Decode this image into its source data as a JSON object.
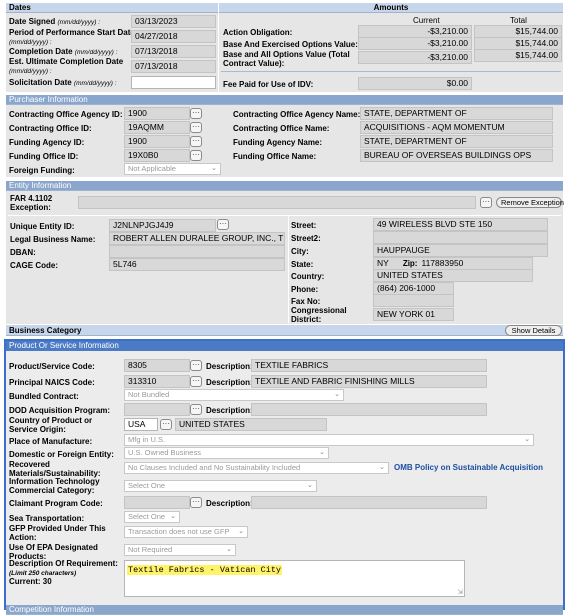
{
  "dates": {
    "header": "Dates",
    "date_signed_label": "Date Signed",
    "date_signed_hint": "(mm/dd/yyyy) :",
    "date_signed": "03/13/2023",
    "pop_start_label": "Period of Performance Start Date",
    "pop_start_hint": "(mm/dd/yyyy) :",
    "pop_start": "04/27/2018",
    "completion_label": "Completion Date",
    "completion_hint": "(mm/dd/yyyy) :",
    "completion": "07/13/2018",
    "ult_completion_label": "Est. Ultimate Completion Date",
    "ult_completion_hint": "(mm/dd/yyyy) :",
    "ult_completion": "07/13/2018",
    "solicitation_label": "Solicitation Date",
    "solicitation_hint": "(mm/dd/yyyy) :",
    "solicitation": ""
  },
  "amounts": {
    "header": "Amounts",
    "col_current": "Current",
    "col_total": "Total",
    "action_obligation_label": "Action Obligation:",
    "action_obligation_current": "-$3,210.00",
    "action_obligation_total": "$15,744.00",
    "base_exercised_label": "Base And Exercised Options Value:",
    "base_exercised_current": "-$3,210.00",
    "base_exercised_total": "$15,744.00",
    "base_all_label": "Base and All Options Value (Total Contract Value):",
    "base_all_current": "-$3,210.00",
    "base_all_total": "$15,744.00",
    "fee_label": "Fee Paid for Use of IDV:",
    "fee_value": "$0.00"
  },
  "purchaser": {
    "header": "Purchaser Information",
    "contracting_agency_id_label": "Contracting Office Agency ID:",
    "contracting_agency_id": "1900",
    "contracting_office_id_label": "Contracting Office ID:",
    "contracting_office_id": "19AQMM",
    "funding_agency_id_label": "Funding Agency ID:",
    "funding_agency_id": "1900",
    "funding_office_id_label": "Funding Office ID:",
    "funding_office_id": "19X0B0",
    "foreign_funding_label": "Foreign Funding:",
    "foreign_funding": "Not Applicable",
    "contracting_agency_name_label": "Contracting Office Agency Name:",
    "contracting_agency_name": "STATE, DEPARTMENT OF",
    "contracting_office_name_label": "Contracting Office Name:",
    "contracting_office_name": "ACQUISITIONS - AQM MOMENTUM",
    "funding_agency_name_label": "Funding Agency Name:",
    "funding_agency_name": "STATE, DEPARTMENT OF",
    "funding_office_name_label": "Funding Office Name:",
    "funding_office_name": "BUREAU OF OVERSEAS BUILDINGS OPS"
  },
  "entity": {
    "header": "Entity Information",
    "far_label": "FAR 4.1102 Exception:",
    "far_value": "",
    "remove_exception": "Remove Exception",
    "uei_label": "Unique Entity ID:",
    "uei": "J2NLNPJGJ4J9",
    "legal_name_label": "Legal Business Name:",
    "legal_name": "ROBERT ALLEN DURALEE GROUP, INC., T",
    "dban_label": "DBAN:",
    "dban": "",
    "cage_label": "CAGE Code:",
    "cage": "5L746",
    "street_label": "Street:",
    "street": "49 WIRELESS BLVD STE 150",
    "street2_label": "Street2:",
    "street2": "",
    "city_label": "City:",
    "city": "HAUPPAUGE",
    "state_label": "State:",
    "state": "NY",
    "zip_label": "Zip:",
    "zip": "117883950",
    "country_label": "Country:",
    "country": "UNITED STATES",
    "phone_label": "Phone:",
    "phone": "(864) 206-1000",
    "fax_label": "Fax No:",
    "fax": "",
    "district_label": "Congressional District:",
    "district": "NEW YORK 01"
  },
  "business_category": {
    "header": "Business Category",
    "show_details": "Show Details"
  },
  "product": {
    "header": "Product Or Service Information",
    "psc_label": "Product/Service Code:",
    "psc": "8305",
    "psc_desc_label": "Description:",
    "psc_desc": "TEXTILE FABRICS",
    "naics_label": "Principal NAICS Code:",
    "naics": "313310",
    "naics_desc_label": "Description:",
    "naics_desc": "TEXTILE AND FABRIC FINISHING MILLS",
    "bundled_label": "Bundled Contract:",
    "bundled": "Not Bundled",
    "dod_label": "DOD Acquisition Program:",
    "dod_desc_label": "Description:",
    "country_label": "Country of Product or Service Origin:",
    "country_code": "USA",
    "country_name": "UNITED STATES",
    "place_label": "Place of Manufacture:",
    "place": "Mfg in U.S.",
    "domestic_label": "Domestic or Foreign Entity:",
    "domestic": "U.S. Owned Business",
    "recovered_label": "Recovered Materials/Sustainability:",
    "recovered": "No Clauses Included and No Sustainability Included",
    "omb_link": "OMB Policy on Sustainable Acquisition",
    "it_label": "Information Technology Commercial Category:",
    "it": "Select One",
    "claimant_label": "Claimant Program Code:",
    "claimant_desc_label": "Description:",
    "sea_label": "Sea Transportation:",
    "sea": "Select One",
    "gfp_label": "GFP Provided Under This Action:",
    "gfp": "Transaction does not use GFP",
    "epa_label": "Use Of EPA Designated Products:",
    "epa": "Not Required",
    "req_label": "Description Of Requirement:",
    "req_limit": "(Limit 250 characters)",
    "req_current": "Current: 30",
    "req_value": "Textile Fabrics - Vatican City"
  },
  "competition": {
    "header": "Competition Information"
  }
}
